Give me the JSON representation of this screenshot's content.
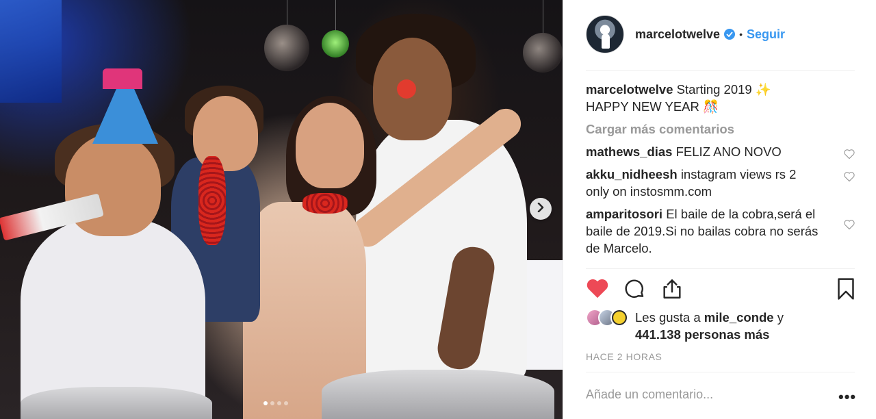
{
  "post": {
    "username": "marcelotwelve",
    "follow_label": "Seguir",
    "separator": "•",
    "carousel": {
      "slide_count": 4,
      "active_index": 0
    },
    "caption": {
      "user": "marcelotwelve",
      "line1": "Starting 2019 ✨",
      "line2": "HAPPY NEW YEAR 🎊"
    },
    "load_more_label": "Cargar más comentarios",
    "comments": [
      {
        "user": "mathews_dias",
        "text": "FELIZ ANO NOVO"
      },
      {
        "user": "akku_nidheesh",
        "text": "instagram views rs 2 only on instosmm.com"
      },
      {
        "user": "amparitosori",
        "text": "El baile de la cobra,será el baile de 2019.Si no bailas cobra no serás de Marcelo."
      }
    ],
    "likes": {
      "prefix": "Les gusta a",
      "liker": "mile_conde",
      "connector": "y",
      "count": "441.138 personas más"
    },
    "time": "HACE 2 HORAS",
    "add_comment_placeholder": "Añade un comentario...",
    "more_label": "•••",
    "liked": true
  },
  "colors": {
    "accent": "#3897f0",
    "like": "#ed4956",
    "muted": "#999999"
  },
  "icons": [
    "verified-icon",
    "chevron-right-icon",
    "heart-icon",
    "comment-icon",
    "share-icon",
    "bookmark-icon",
    "heart-outline-icon"
  ]
}
